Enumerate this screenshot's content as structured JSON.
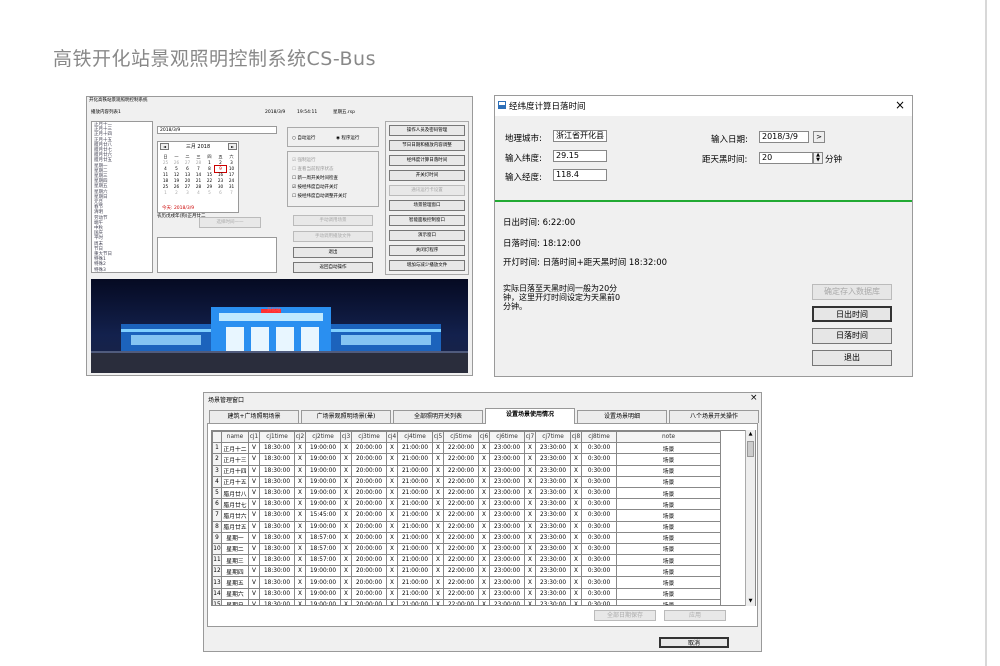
{
  "page": {
    "title": "高铁开化站景观照明控制系统CS-Bus"
  },
  "main_window": {
    "title": "开化高铁站景观照明控制系统",
    "list_label": "播放内容列表1",
    "date": "2018/3/9",
    "time": "19:54:11",
    "file": "星期五.rsp",
    "list_items": [
      "正月十二",
      "正月十三",
      "正月十四",
      "正月十五",
      "腊月廿八",
      "腊月廿七",
      "腊月廿六",
      "腊月廿五",
      "星期一",
      "星期二",
      "星期三",
      "星期四",
      "星期五",
      "星期六",
      "星期日",
      "元旦",
      "春节",
      "清明",
      "劳动节",
      "端午",
      "中秋",
      "国庆",
      "平时",
      "周末",
      "节日",
      "重大节日",
      "特殊1",
      "特殊2",
      "特殊3",
      "全开"
    ],
    "date_input": "2018/3/9",
    "calendar": {
      "month_label": "三月 2018",
      "prev": "◄",
      "next": "►",
      "weekdays": [
        "日",
        "一",
        "二",
        "三",
        "四",
        "五",
        "六"
      ],
      "days": [
        [
          "25",
          1
        ],
        [
          "26",
          1
        ],
        [
          "27",
          1
        ],
        [
          "28",
          1
        ],
        [
          "1",
          0
        ],
        [
          "2",
          0
        ],
        [
          "3",
          0
        ],
        [
          "4",
          0
        ],
        [
          "5",
          0
        ],
        [
          "6",
          0
        ],
        [
          "7",
          0
        ],
        [
          "8",
          0
        ],
        [
          "9",
          2
        ],
        [
          "10",
          0
        ],
        [
          "11",
          0
        ],
        [
          "12",
          0
        ],
        [
          "13",
          0
        ],
        [
          "14",
          0
        ],
        [
          "15",
          0
        ],
        [
          "16",
          0
        ],
        [
          "17",
          0
        ],
        [
          "18",
          0
        ],
        [
          "19",
          0
        ],
        [
          "20",
          0
        ],
        [
          "21",
          0
        ],
        [
          "22",
          0
        ],
        [
          "23",
          0
        ],
        [
          "24",
          0
        ],
        [
          "25",
          0
        ],
        [
          "26",
          0
        ],
        [
          "27",
          0
        ],
        [
          "28",
          0
        ],
        [
          "29",
          0
        ],
        [
          "30",
          0
        ],
        [
          "31",
          0
        ],
        [
          "1",
          1
        ],
        [
          "2",
          1
        ],
        [
          "3",
          1
        ],
        [
          "4",
          1
        ],
        [
          "5",
          1
        ],
        [
          "6",
          1
        ],
        [
          "7",
          1
        ]
      ],
      "today_text": "今天: 2018/3/9"
    },
    "sub_text": "农历戊戌年(狗)正月廿二",
    "select_time_button": "选择时间一一",
    "radio_auto": "自动运行",
    "radio_manual": "程序运行",
    "checks": [
      "强制运行",
      "查看当前程序状态",
      "新一周开关时间检查",
      "按经纬度自动开关灯",
      "按经纬度自动调整开关灯"
    ],
    "btn_manual_scene": "手动调用场景",
    "btn_manual_file": "手动调用播放文件",
    "btn_exit": "退出",
    "btn_back_auto": "返回自动操作",
    "right_buttons": [
      "操作人员及密码管理",
      "节日日期和播放内容调整",
      "经纬度计算日落时间",
      "开关灯时间",
      "通讯运行卡设置",
      "场景管理窗口",
      "智能面板控制窗口",
      "演示窗口",
      "关闭灯程序",
      "增加与减少播放文件"
    ],
    "photo_sign": "开化站"
  },
  "sun_window": {
    "title": "经纬度计算日落时间",
    "close": "×",
    "city_label": "地理城市:",
    "city_value": "浙江省开化县",
    "lat_label": "输入纬度:",
    "lat_value": "29.15",
    "lon_label": "输入经度:",
    "lon_value": "118.4",
    "date_label": "输入日期:",
    "date_value": "2018/3/9",
    "date_btn": ">",
    "dark_label": "距天黑时间:",
    "dark_value": "20",
    "dark_unit": "分钟",
    "sunrise": "日出时间:    6:22:00",
    "sunset": "日落时间:    18:12:00",
    "lighton": "开灯时间: 日落时间+距天黑时间    18:32:00",
    "note": "实际日落至天黑时间一般为20分钟，这里开灯时间设定为天黑前0分钟。",
    "btn_save": "确定存入数据库",
    "btn_sunrise": "日出时间",
    "btn_sunset": "日落时间",
    "btn_exit": "退出"
  },
  "scene_window": {
    "title": "场景管理窗口",
    "close": "×",
    "tabs": [
      "建筑+广场照明场景",
      "广场景观照明场景(晕)",
      "全部照明开关列表",
      "设置场景使用情况",
      "设置场景明细",
      "八个场景开关操作"
    ],
    "active_tab": 3,
    "columns": [
      "",
      "name",
      "cj1",
      "cj1time",
      "cj2",
      "cj2time",
      "cj3",
      "cj3time",
      "cj4",
      "cj4time",
      "cj5",
      "cj5time",
      "cj6",
      "cj6time",
      "cj7",
      "cj7time",
      "cj8",
      "cj8time",
      "note"
    ],
    "rows": [
      [
        "1",
        "正月十二",
        "V",
        "18:30:00",
        "X",
        "19:00:00",
        "X",
        "20:00:00",
        "X",
        "21:00:00",
        "X",
        "22:00:00",
        "X",
        "23:00:00",
        "X",
        "23:30:00",
        "X",
        "0:30:00",
        "场景"
      ],
      [
        "2",
        "正月十三",
        "V",
        "18:30:00",
        "X",
        "19:00:00",
        "X",
        "20:00:00",
        "X",
        "21:00:00",
        "X",
        "22:00:00",
        "X",
        "23:00:00",
        "X",
        "23:30:00",
        "X",
        "0:30:00",
        "场景"
      ],
      [
        "3",
        "正月十四",
        "V",
        "18:30:00",
        "X",
        "19:00:00",
        "X",
        "20:00:00",
        "X",
        "21:00:00",
        "X",
        "22:00:00",
        "X",
        "23:00:00",
        "X",
        "23:30:00",
        "X",
        "0:30:00",
        "场景"
      ],
      [
        "4",
        "正月十五",
        "V",
        "18:30:00",
        "X",
        "19:00:00",
        "X",
        "20:00:00",
        "X",
        "21:00:00",
        "X",
        "22:00:00",
        "X",
        "23:00:00",
        "X",
        "23:30:00",
        "X",
        "0:30:00",
        "场景"
      ],
      [
        "5",
        "腊月廿八",
        "V",
        "18:30:00",
        "X",
        "19:00:00",
        "X",
        "20:00:00",
        "X",
        "21:00:00",
        "X",
        "22:00:00",
        "X",
        "23:00:00",
        "X",
        "23:30:00",
        "X",
        "0:30:00",
        "场景"
      ],
      [
        "6",
        "腊月廿七",
        "V",
        "18:30:00",
        "X",
        "19:00:00",
        "X",
        "20:00:00",
        "X",
        "21:00:00",
        "X",
        "22:00:00",
        "X",
        "23:00:00",
        "X",
        "23:30:00",
        "X",
        "0:30:00",
        "场景"
      ],
      [
        "7",
        "腊月廿六",
        "V",
        "18:30:00",
        "X",
        "15:45:00",
        "X",
        "20:00:00",
        "X",
        "21:00:00",
        "X",
        "22:00:00",
        "X",
        "23:00:00",
        "X",
        "23:30:00",
        "X",
        "0:30:00",
        "场景"
      ],
      [
        "8",
        "腊月廿五",
        "V",
        "18:30:00",
        "X",
        "19:00:00",
        "X",
        "20:00:00",
        "X",
        "21:00:00",
        "X",
        "22:00:00",
        "X",
        "23:00:00",
        "X",
        "23:30:00",
        "X",
        "0:30:00",
        "场景"
      ],
      [
        "9",
        "星期一",
        "V",
        "18:30:00",
        "X",
        "18:57:00",
        "X",
        "20:00:00",
        "X",
        "21:00:00",
        "X",
        "22:00:00",
        "X",
        "23:00:00",
        "X",
        "23:30:00",
        "X",
        "0:30:00",
        "场景"
      ],
      [
        "10",
        "星期二",
        "V",
        "18:30:00",
        "X",
        "18:57:00",
        "X",
        "20:00:00",
        "X",
        "21:00:00",
        "X",
        "22:00:00",
        "X",
        "23:00:00",
        "X",
        "23:30:00",
        "X",
        "0:30:00",
        "场景"
      ],
      [
        "11",
        "星期三",
        "V",
        "18:30:00",
        "X",
        "18:57:00",
        "X",
        "20:00:00",
        "X",
        "21:00:00",
        "X",
        "22:00:00",
        "X",
        "23:00:00",
        "X",
        "23:30:00",
        "X",
        "0:30:00",
        "场景"
      ],
      [
        "12",
        "星期四",
        "V",
        "18:30:00",
        "X",
        "19:00:00",
        "X",
        "20:00:00",
        "X",
        "21:00:00",
        "X",
        "22:00:00",
        "X",
        "23:00:00",
        "X",
        "23:30:00",
        "X",
        "0:30:00",
        "场景"
      ],
      [
        "13",
        "星期五",
        "V",
        "18:30:00",
        "X",
        "19:00:00",
        "X",
        "20:00:00",
        "X",
        "21:00:00",
        "X",
        "22:00:00",
        "X",
        "23:00:00",
        "X",
        "23:30:00",
        "X",
        "0:30:00",
        "场景"
      ],
      [
        "14",
        "星期六",
        "V",
        "18:30:00",
        "X",
        "19:00:00",
        "X",
        "20:00:00",
        "X",
        "21:00:00",
        "X",
        "22:00:00",
        "X",
        "23:00:00",
        "X",
        "23:30:00",
        "X",
        "0:30:00",
        "场景"
      ],
      [
        "15",
        "星期日",
        "V",
        "18:30:00",
        "X",
        "19:00:00",
        "X",
        "20:00:00",
        "X",
        "21:00:00",
        "X",
        "22:00:00",
        "X",
        "23:00:00",
        "X",
        "23:30:00",
        "X",
        "0:30:00",
        "场景"
      ]
    ],
    "btn_save_all": "全部日期保存",
    "btn_apply": "应用",
    "btn_cancel": "取消"
  },
  "colors": {
    "accent_green": "#22aa33",
    "title_grey": "#888888",
    "calendar_red": "#cc0000"
  }
}
